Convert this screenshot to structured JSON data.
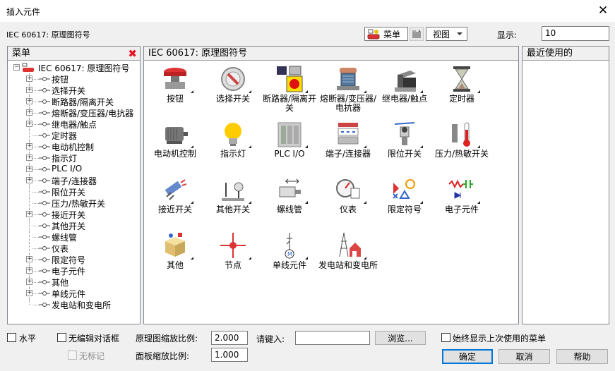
{
  "window": {
    "title": "插入元件",
    "close": "✕"
  },
  "toolbar": {
    "path": "IEC 60617: 原理图符号",
    "menu_label": "菜单",
    "view_label": "视图",
    "display_label": "显示:",
    "display_value": "10"
  },
  "menu_panel": {
    "title": "菜单",
    "root": "IEC 60617: 原理图符号",
    "items": [
      {
        "label": "按钮",
        "expandable": true
      },
      {
        "label": "选择开关",
        "expandable": true
      },
      {
        "label": "断路器/隔离开关",
        "expandable": true
      },
      {
        "label": "熔断器/变压器/电抗器",
        "expandable": true
      },
      {
        "label": "继电器/触点",
        "expandable": true
      },
      {
        "label": "定时器",
        "expandable": false
      },
      {
        "label": "电动机控制",
        "expandable": true
      },
      {
        "label": "指示灯",
        "expandable": true
      },
      {
        "label": "PLC I/O",
        "expandable": true
      },
      {
        "label": "端子/连接器",
        "expandable": true
      },
      {
        "label": "限位开关",
        "expandable": false
      },
      {
        "label": "压力/热敏开关",
        "expandable": false
      },
      {
        "label": "接近开关",
        "expandable": true
      },
      {
        "label": "其他开关",
        "expandable": false
      },
      {
        "label": "螺线管",
        "expandable": false
      },
      {
        "label": "仪表",
        "expandable": false
      },
      {
        "label": "限定符号",
        "expandable": true
      },
      {
        "label": "电子元件",
        "expandable": true
      },
      {
        "label": "其他",
        "expandable": true
      },
      {
        "label": "单线元件",
        "expandable": true
      },
      {
        "label": "发电站和变电所",
        "expandable": false
      }
    ]
  },
  "center_panel": {
    "title": "IEC 60617: 原理图符号",
    "icons": [
      {
        "label": "按钮",
        "icon": "pushbutton-icon"
      },
      {
        "label": "选择开关",
        "icon": "selector-switch-icon"
      },
      {
        "label": "断路器/隔离开关",
        "icon": "breaker-icon"
      },
      {
        "label": "熔断器/变压器/电抗器",
        "icon": "transformer-icon"
      },
      {
        "label": "继电器/触点",
        "icon": "relay-icon"
      },
      {
        "label": "定时器",
        "icon": "hourglass-icon"
      },
      {
        "label": "电动机控制",
        "icon": "motor-icon"
      },
      {
        "label": "指示灯",
        "icon": "lightbulb-icon"
      },
      {
        "label": "PLC I/O",
        "icon": "plc-icon"
      },
      {
        "label": "端子/连接器",
        "icon": "terminal-icon"
      },
      {
        "label": "限位开关",
        "icon": "limit-switch-icon"
      },
      {
        "label": "压力/热敏开关",
        "icon": "thermometer-icon"
      },
      {
        "label": "接近开关",
        "icon": "proximity-switch-icon"
      },
      {
        "label": "其他开关",
        "icon": "other-switch-icon"
      },
      {
        "label": "螺线管",
        "icon": "solenoid-icon"
      },
      {
        "label": "仪表",
        "icon": "gauge-icon"
      },
      {
        "label": "限定符号",
        "icon": "qualifier-icon"
      },
      {
        "label": "电子元件",
        "icon": "electronic-icon"
      },
      {
        "label": "其他",
        "icon": "box-icon"
      },
      {
        "label": "节点",
        "icon": "node-icon"
      },
      {
        "label": "单线元件",
        "icon": "oneline-icon"
      },
      {
        "label": "发电站和变电所",
        "icon": "powerstation-icon"
      }
    ]
  },
  "recent_panel": {
    "title": "最近使用的"
  },
  "bottom": {
    "horizontal": "水平",
    "no_edit_dialog": "无编辑对话框",
    "no_tag": "无标记",
    "schematic_scale_label": "原理图缩放比例:",
    "schematic_scale_value": "2.000",
    "panel_scale_label": "面板缩放比例:",
    "panel_scale_value": "1.000",
    "enter_label": "请键入:",
    "enter_value": "",
    "browse": "浏览...",
    "always_show_last": "始终显示上次使用的菜单",
    "ok": "确定",
    "cancel": "取消",
    "help": "帮助"
  },
  "colors": {
    "accent": "#0078d7",
    "red": "#e81123"
  }
}
